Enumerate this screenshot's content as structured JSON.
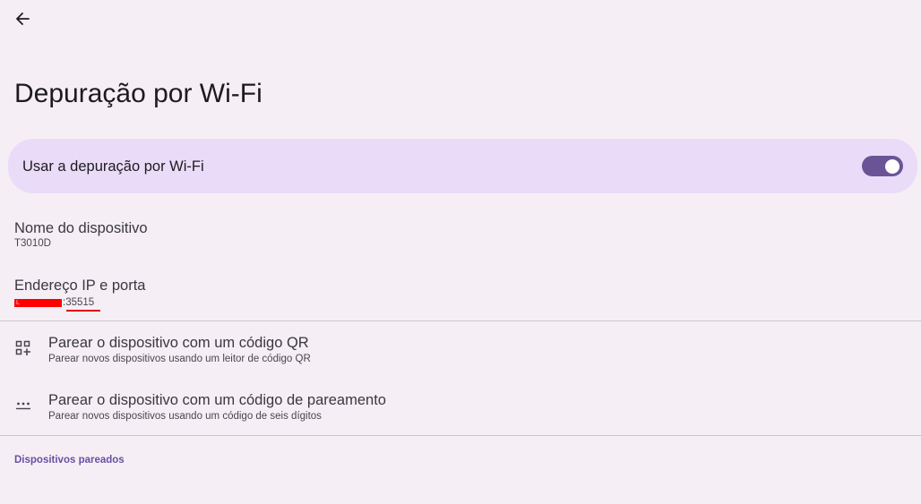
{
  "header": {
    "back_icon": "arrow-back-icon",
    "title": "Depuração por Wi-Fi"
  },
  "main_switch": {
    "label": "Usar a depuração por Wi-Fi",
    "enabled": true,
    "track_color": "#6b5496",
    "card_color": "#eadcf8"
  },
  "device_name": {
    "title": "Nome do dispositivo",
    "value": "T3010D"
  },
  "ip_address": {
    "title": "Endereço IP e porta",
    "port_text": ":35515",
    "redaction_mark": "L"
  },
  "pair_options": [
    {
      "icon": "qr-code-scanner-icon",
      "title": "Parear o dispositivo com um código QR",
      "summary": "Parear novos dispositivos usando um leitor de código QR"
    },
    {
      "icon": "password-dots-icon",
      "title": "Parear o dispositivo com um código de pareamento",
      "summary": "Parear novos dispositivos usando um código de seis dígitos"
    }
  ],
  "paired_devices": {
    "header": "Dispositivos pareados"
  },
  "colors": {
    "background": "#f5eff5",
    "accent": "#6750a4",
    "divider": "#cac4d0"
  }
}
